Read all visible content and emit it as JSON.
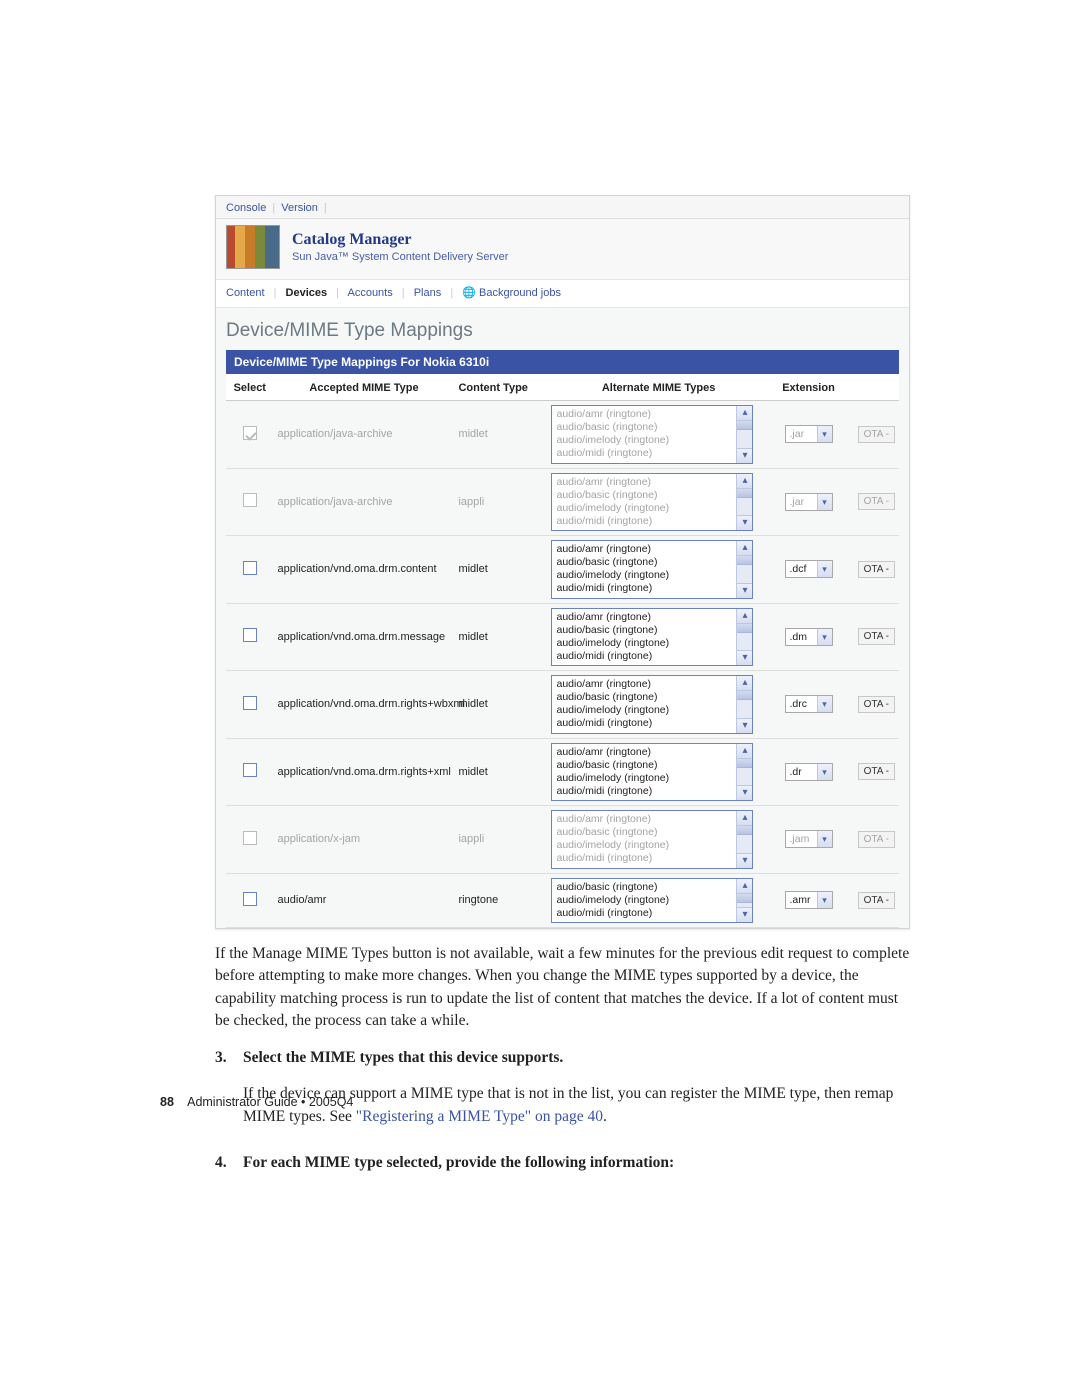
{
  "top_tabs": {
    "console": "Console",
    "version": "Version"
  },
  "banner": {
    "title": "Catalog Manager",
    "sub": "Sun Java™ System Content Delivery Server"
  },
  "nav": {
    "content": "Content",
    "devices": "Devices",
    "accounts": "Accounts",
    "plans": "Plans",
    "bg": "Background jobs"
  },
  "page_title": "Device/MIME Type Mappings",
  "section_bar": "Device/MIME Type Mappings For Nokia 6310i",
  "cols": {
    "select": "Select",
    "accepted": "Accepted MIME Type",
    "content": "Content Type",
    "alternate": "Alternate MIME Types",
    "extension": "Extension"
  },
  "alt_mimes4": [
    "audio/amr (ringtone)",
    "audio/basic (ringtone)",
    "audio/imelody (ringtone)",
    "audio/midi (ringtone)"
  ],
  "alt_mimes3": [
    "audio/basic (ringtone)",
    "audio/imelody (ringtone)",
    "audio/midi (ringtone)"
  ],
  "rows": [
    {
      "disabled": true,
      "checked": true,
      "mime": "application/java-archive",
      "type": "midlet",
      "alt": 4,
      "ext": ".jar",
      "ota": "OTA -"
    },
    {
      "disabled": true,
      "checked": false,
      "mime": "application/java-archive",
      "type": "iappli",
      "alt": 4,
      "ext": ".jar",
      "ota": "OTA -"
    },
    {
      "disabled": false,
      "checked": false,
      "mime": "application/vnd.oma.drm.content",
      "type": "midlet",
      "alt": 4,
      "ext": ".dcf",
      "ota": "OTA -"
    },
    {
      "disabled": false,
      "checked": false,
      "mime": "application/vnd.oma.drm.message",
      "type": "midlet",
      "alt": 4,
      "ext": ".dm",
      "ota": "OTA -"
    },
    {
      "disabled": false,
      "checked": false,
      "mime": "application/vnd.oma.drm.rights+wbxml",
      "type": "midlet",
      "alt": 4,
      "ext": ".drc",
      "ota": "OTA -"
    },
    {
      "disabled": false,
      "checked": false,
      "mime": "application/vnd.oma.drm.rights+xml",
      "type": "midlet",
      "alt": 4,
      "ext": ".dr",
      "ota": "OTA -"
    },
    {
      "disabled": true,
      "checked": false,
      "mime": "application/x-jam",
      "type": "iappli",
      "alt": 4,
      "ext": ".jam",
      "ota": "OTA -"
    },
    {
      "disabled": false,
      "checked": false,
      "mime": "audio/amr",
      "type": "ringtone",
      "alt": 3,
      "ext": ".amr",
      "ota": "OTA -"
    }
  ],
  "body": {
    "p1": "If the Manage MIME Types button is not available, wait a few minutes for the previous edit request to complete before attempting to make more changes. When you change the MIME types supported by a device, the capability matching process is run to update the list of content that matches the device. If a lot of content must be checked, the process can take a while.",
    "step3_num": "3.",
    "step3_head": "Select the MIME types that this device supports.",
    "step3_text_a": "If the device can support a MIME type that is not in the list, you can register the MIME type, then remap MIME types. See ",
    "step3_link": "\"Registering a MIME Type\" on page 40",
    "step3_text_b": ".",
    "step4_num": "4.",
    "step4_head": "For each MIME type selected, provide the following information:"
  },
  "footer": {
    "page_num": "88",
    "doc": "Administrator Guide • 2005Q4"
  }
}
